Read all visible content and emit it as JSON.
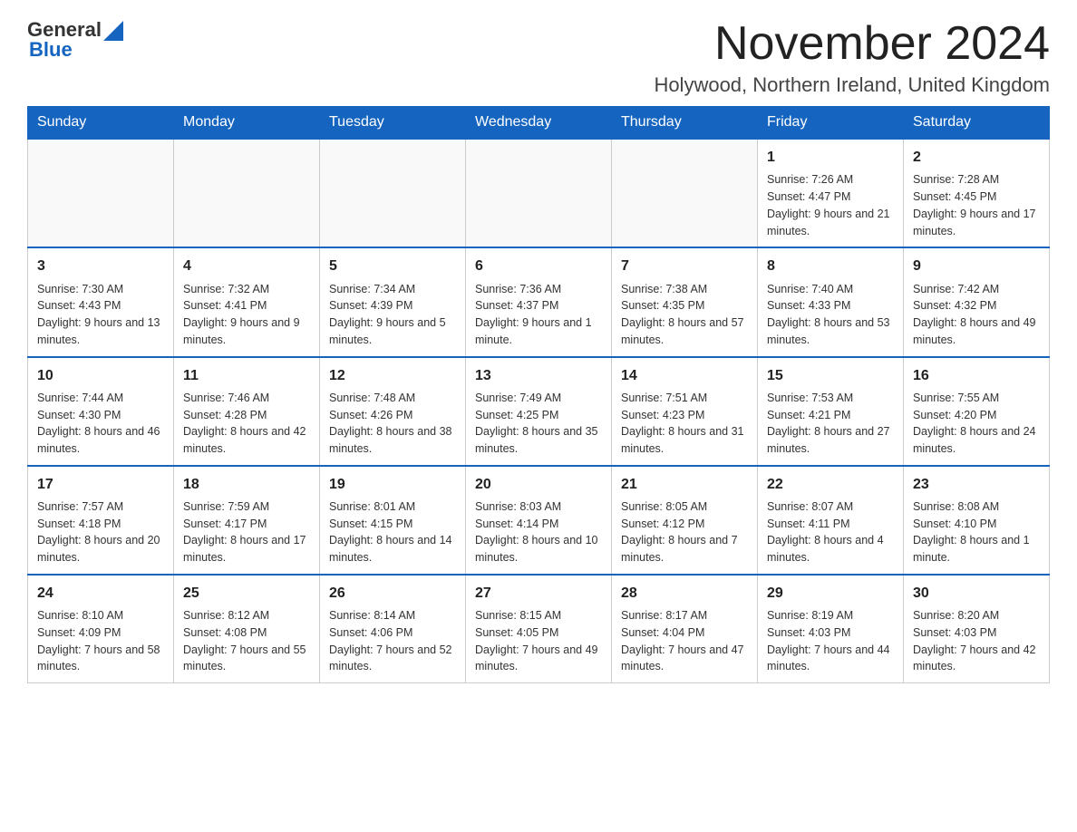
{
  "header": {
    "logo_general": "General",
    "logo_blue": "Blue",
    "title": "November 2024",
    "subtitle": "Holywood, Northern Ireland, United Kingdom"
  },
  "calendar": {
    "days_of_week": [
      "Sunday",
      "Monday",
      "Tuesday",
      "Wednesday",
      "Thursday",
      "Friday",
      "Saturday"
    ],
    "weeks": [
      [
        {
          "day": "",
          "info": ""
        },
        {
          "day": "",
          "info": ""
        },
        {
          "day": "",
          "info": ""
        },
        {
          "day": "",
          "info": ""
        },
        {
          "day": "",
          "info": ""
        },
        {
          "day": "1",
          "info": "Sunrise: 7:26 AM\nSunset: 4:47 PM\nDaylight: 9 hours and 21 minutes."
        },
        {
          "day": "2",
          "info": "Sunrise: 7:28 AM\nSunset: 4:45 PM\nDaylight: 9 hours and 17 minutes."
        }
      ],
      [
        {
          "day": "3",
          "info": "Sunrise: 7:30 AM\nSunset: 4:43 PM\nDaylight: 9 hours and 13 minutes."
        },
        {
          "day": "4",
          "info": "Sunrise: 7:32 AM\nSunset: 4:41 PM\nDaylight: 9 hours and 9 minutes."
        },
        {
          "day": "5",
          "info": "Sunrise: 7:34 AM\nSunset: 4:39 PM\nDaylight: 9 hours and 5 minutes."
        },
        {
          "day": "6",
          "info": "Sunrise: 7:36 AM\nSunset: 4:37 PM\nDaylight: 9 hours and 1 minute."
        },
        {
          "day": "7",
          "info": "Sunrise: 7:38 AM\nSunset: 4:35 PM\nDaylight: 8 hours and 57 minutes."
        },
        {
          "day": "8",
          "info": "Sunrise: 7:40 AM\nSunset: 4:33 PM\nDaylight: 8 hours and 53 minutes."
        },
        {
          "day": "9",
          "info": "Sunrise: 7:42 AM\nSunset: 4:32 PM\nDaylight: 8 hours and 49 minutes."
        }
      ],
      [
        {
          "day": "10",
          "info": "Sunrise: 7:44 AM\nSunset: 4:30 PM\nDaylight: 8 hours and 46 minutes."
        },
        {
          "day": "11",
          "info": "Sunrise: 7:46 AM\nSunset: 4:28 PM\nDaylight: 8 hours and 42 minutes."
        },
        {
          "day": "12",
          "info": "Sunrise: 7:48 AM\nSunset: 4:26 PM\nDaylight: 8 hours and 38 minutes."
        },
        {
          "day": "13",
          "info": "Sunrise: 7:49 AM\nSunset: 4:25 PM\nDaylight: 8 hours and 35 minutes."
        },
        {
          "day": "14",
          "info": "Sunrise: 7:51 AM\nSunset: 4:23 PM\nDaylight: 8 hours and 31 minutes."
        },
        {
          "day": "15",
          "info": "Sunrise: 7:53 AM\nSunset: 4:21 PM\nDaylight: 8 hours and 27 minutes."
        },
        {
          "day": "16",
          "info": "Sunrise: 7:55 AM\nSunset: 4:20 PM\nDaylight: 8 hours and 24 minutes."
        }
      ],
      [
        {
          "day": "17",
          "info": "Sunrise: 7:57 AM\nSunset: 4:18 PM\nDaylight: 8 hours and 20 minutes."
        },
        {
          "day": "18",
          "info": "Sunrise: 7:59 AM\nSunset: 4:17 PM\nDaylight: 8 hours and 17 minutes."
        },
        {
          "day": "19",
          "info": "Sunrise: 8:01 AM\nSunset: 4:15 PM\nDaylight: 8 hours and 14 minutes."
        },
        {
          "day": "20",
          "info": "Sunrise: 8:03 AM\nSunset: 4:14 PM\nDaylight: 8 hours and 10 minutes."
        },
        {
          "day": "21",
          "info": "Sunrise: 8:05 AM\nSunset: 4:12 PM\nDaylight: 8 hours and 7 minutes."
        },
        {
          "day": "22",
          "info": "Sunrise: 8:07 AM\nSunset: 4:11 PM\nDaylight: 8 hours and 4 minutes."
        },
        {
          "day": "23",
          "info": "Sunrise: 8:08 AM\nSunset: 4:10 PM\nDaylight: 8 hours and 1 minute."
        }
      ],
      [
        {
          "day": "24",
          "info": "Sunrise: 8:10 AM\nSunset: 4:09 PM\nDaylight: 7 hours and 58 minutes."
        },
        {
          "day": "25",
          "info": "Sunrise: 8:12 AM\nSunset: 4:08 PM\nDaylight: 7 hours and 55 minutes."
        },
        {
          "day": "26",
          "info": "Sunrise: 8:14 AM\nSunset: 4:06 PM\nDaylight: 7 hours and 52 minutes."
        },
        {
          "day": "27",
          "info": "Sunrise: 8:15 AM\nSunset: 4:05 PM\nDaylight: 7 hours and 49 minutes."
        },
        {
          "day": "28",
          "info": "Sunrise: 8:17 AM\nSunset: 4:04 PM\nDaylight: 7 hours and 47 minutes."
        },
        {
          "day": "29",
          "info": "Sunrise: 8:19 AM\nSunset: 4:03 PM\nDaylight: 7 hours and 44 minutes."
        },
        {
          "day": "30",
          "info": "Sunrise: 8:20 AM\nSunset: 4:03 PM\nDaylight: 7 hours and 42 minutes."
        }
      ]
    ]
  }
}
